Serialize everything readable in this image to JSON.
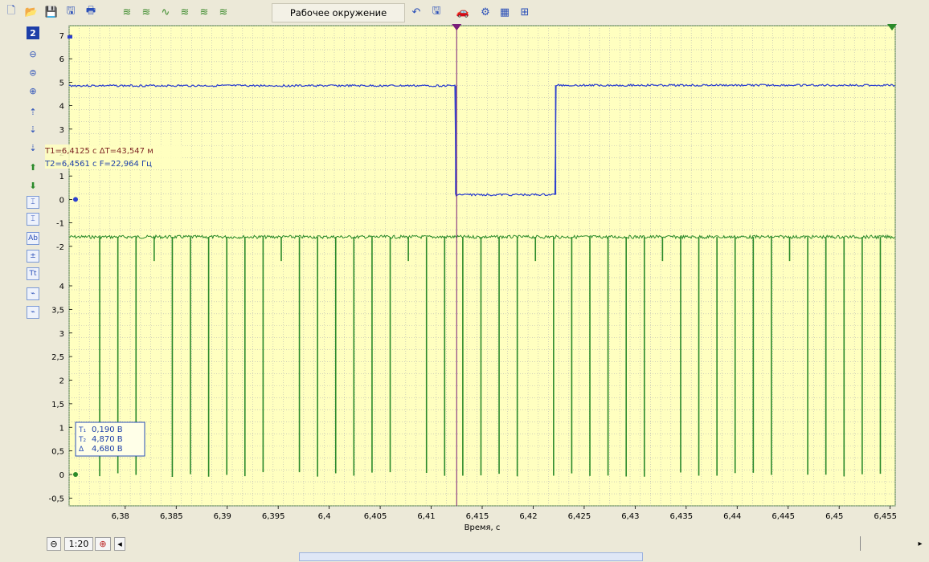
{
  "toolbar": {
    "workspace_label": "Рабочее окружение",
    "icons": [
      "new-file-icon",
      "open-folder-icon",
      "save-icon",
      "save-as-icon",
      "print-icon",
      "wave-1-icon",
      "wave-2-icon",
      "wave-3-icon",
      "wave-4-icon",
      "wave-5-icon",
      "wave-6-icon",
      "undo-icon",
      "save-workspace-icon",
      "car-icon",
      "settings-icon",
      "chart-icon",
      "add-icon"
    ]
  },
  "sidebar": {
    "channel_badge": "2",
    "items": [
      "zoom-out-icon",
      "zoom-reset-icon",
      "zoom-in-icon",
      "shift-up-icon",
      "shift-down-icon",
      "shift-down-small-icon",
      "up-arrow-icon",
      "down-arrow-icon",
      "cursor-icon",
      "cursor-2-icon",
      "text-icon",
      "measure-icon",
      "labels-icon",
      "graph-icon",
      "graph-2-icon"
    ]
  },
  "cursor_info": {
    "t1_line": "T1=6,4125 с ΔT=43,547 м",
    "t2_line": "T2=6,4561 с F=22,964 Гц"
  },
  "measurements": {
    "row1": "0,190 В",
    "row2": "4,870 В",
    "row3": "4,680 В"
  },
  "colors": {
    "plot_bg": "#ffffc0",
    "grid": "#b4b4b4",
    "blue_trace": "#2b3fcf",
    "green_trace": "#2a8a2a",
    "cursor": "#7a1f7a",
    "toolbar_bg": "#ece9d8"
  },
  "chart_data": {
    "type": "line",
    "xlabel": "Время, с",
    "xlim": [
      6.3745,
      6.4555
    ],
    "x_ticks": [
      "6,38",
      "6,385",
      "6,39",
      "6,395",
      "6,4",
      "6,405",
      "6,41",
      "6,415",
      "6,42",
      "6,425",
      "6,43",
      "6,435",
      "6,44",
      "6,445",
      "6,45",
      "6,455"
    ],
    "upper_axis": {
      "ylim": [
        0.5,
        7.2
      ],
      "ticks": [
        "7",
        "6",
        "5",
        "4",
        "3",
        "2",
        "1",
        "0",
        "-1",
        "-2"
      ],
      "tick_values": [
        7,
        6,
        5,
        4,
        3,
        2,
        1,
        0,
        -1,
        -2
      ]
    },
    "lower_axis": {
      "ticks": [
        "4",
        "3,5",
        "3",
        "2,5",
        "2",
        "1,5",
        "1",
        "0,5",
        "0",
        "-0,5"
      ],
      "tick_values": [
        4,
        3.5,
        3,
        2.5,
        2,
        1.5,
        1,
        0.5,
        0,
        -0.5
      ]
    },
    "cursor1_x": 6.4125,
    "cursor2_x": 6.4561,
    "series": [
      {
        "color": "blue",
        "points_x": [
          6.3745,
          6.4124,
          6.4126,
          6.4221,
          6.4223,
          6.4555
        ],
        "points_y": [
          4.85,
          4.85,
          0.2,
          0.2,
          4.87,
          4.87
        ]
      },
      {
        "color": "green",
        "baseline": -1.6,
        "spike_low": 0.0,
        "spike_period": 0.00178,
        "spike_start": 6.3775
      }
    ],
    "zoom_label": "1:20"
  }
}
